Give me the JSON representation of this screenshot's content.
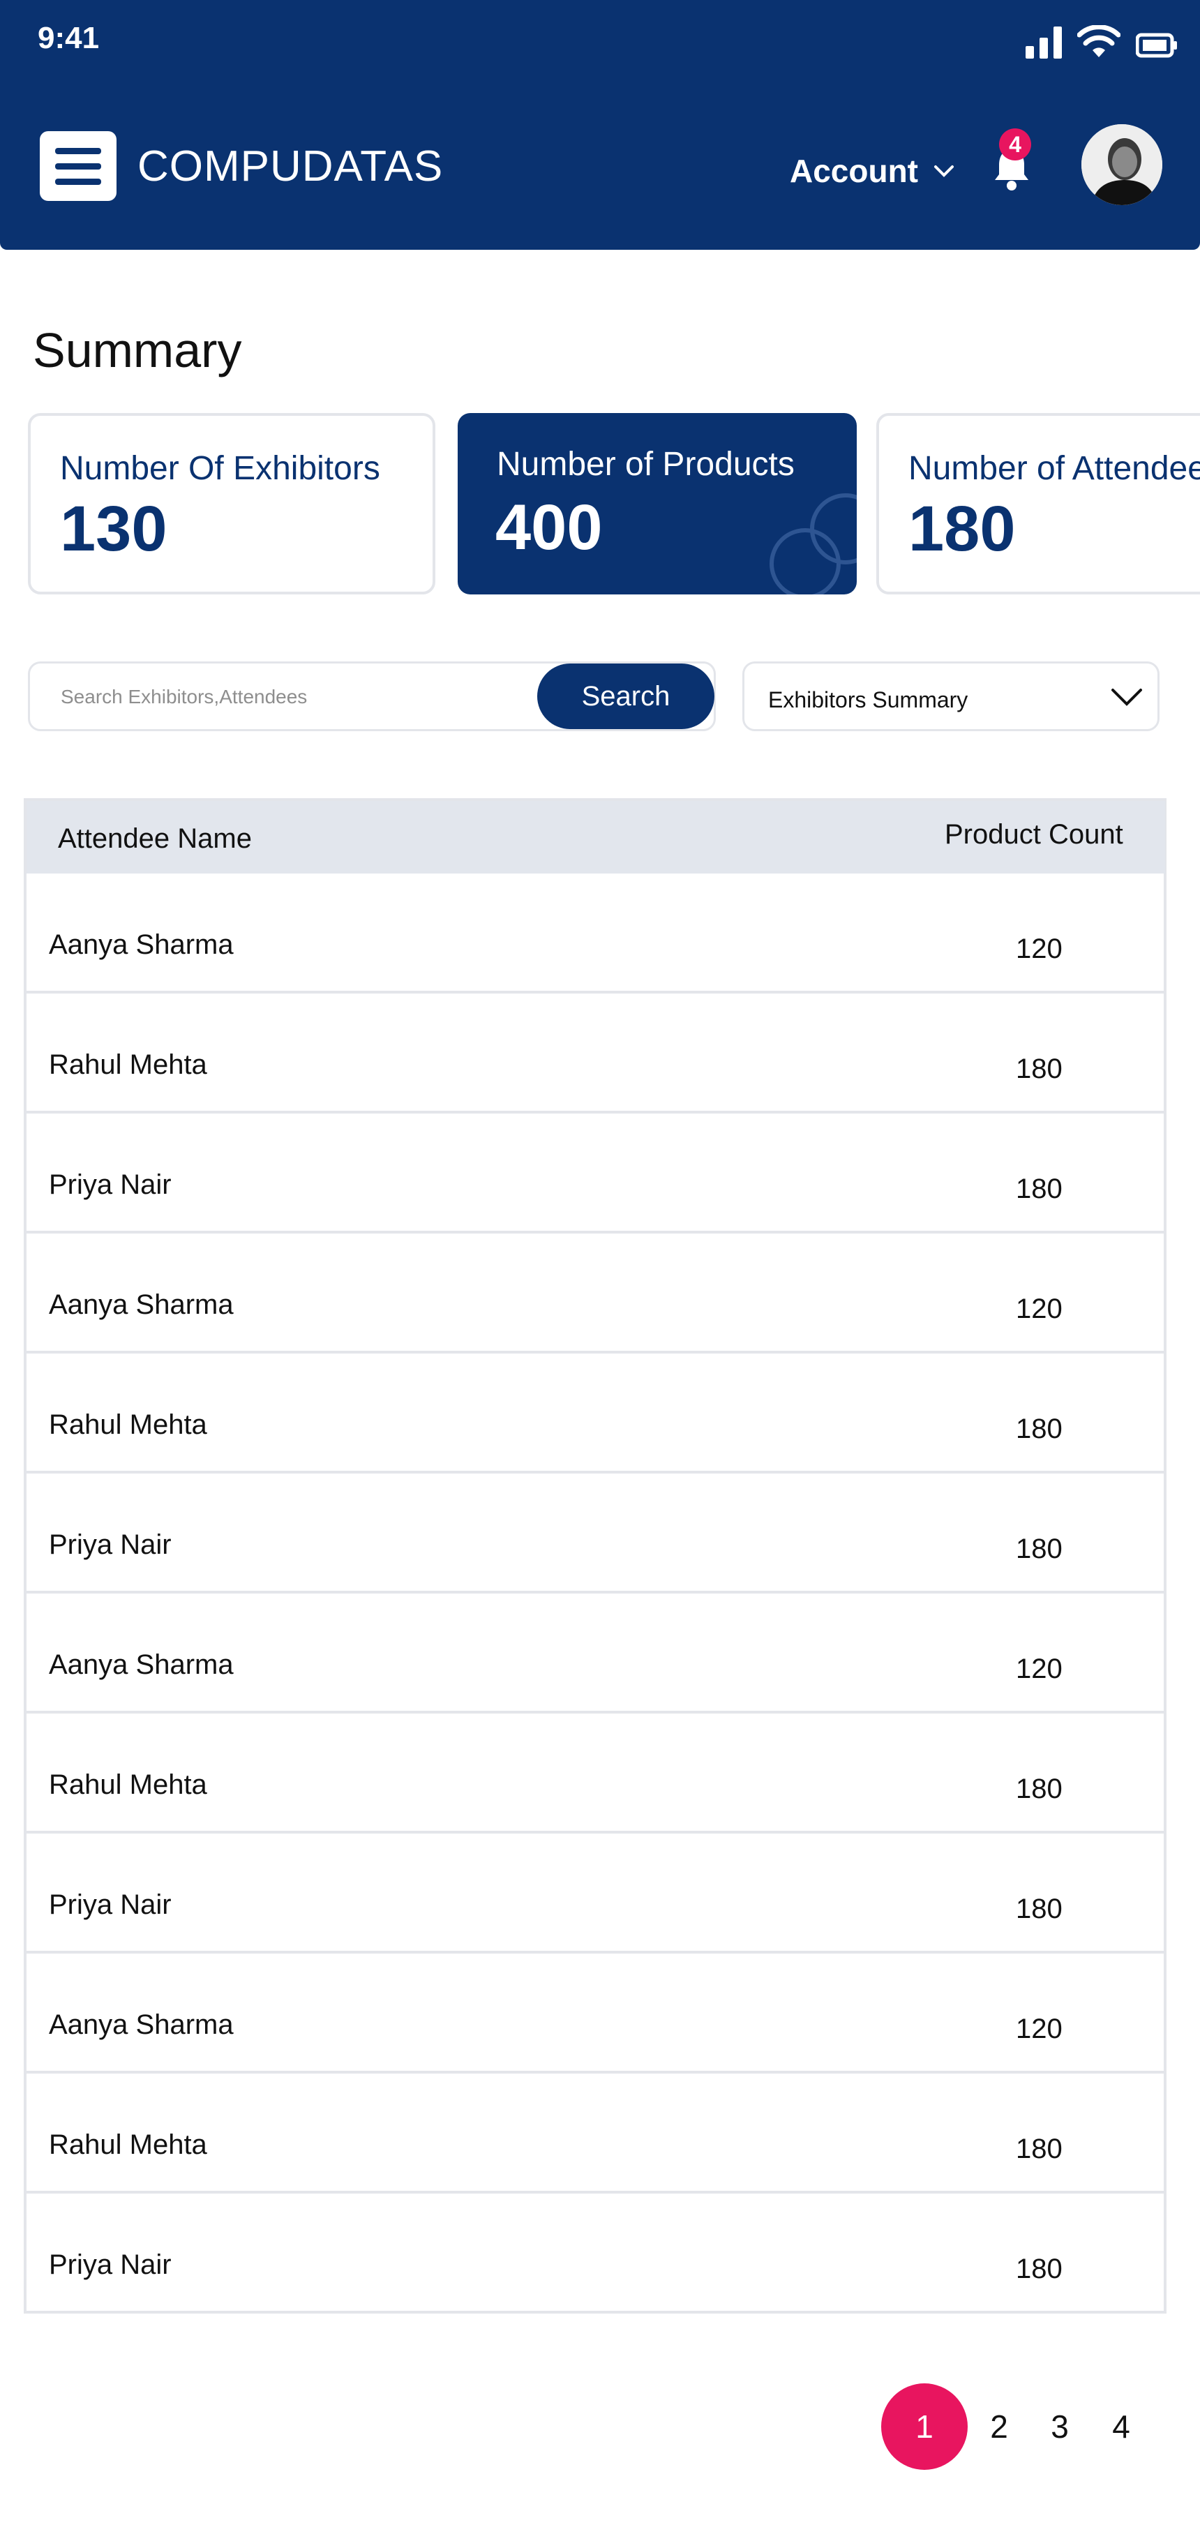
{
  "status_bar": {
    "time": "9:41"
  },
  "header": {
    "brand": "COMPUDATAS",
    "account_label": "Account",
    "notification_count": "4"
  },
  "summary": {
    "title": "Summary",
    "cards": [
      {
        "label": "Number Of Exhibitors",
        "value": "130"
      },
      {
        "label": "Number of Products",
        "value": "400"
      },
      {
        "label": "Number of Attendee",
        "value": "180"
      }
    ]
  },
  "search": {
    "placeholder": "Search Exhibitors,Attendees",
    "button_label": "Search"
  },
  "filter": {
    "selected": "Exhibitors Summary"
  },
  "table": {
    "headers": {
      "name": "Attendee Name",
      "count": "Product Count"
    },
    "rows": [
      {
        "name": "Aanya Sharma",
        "count": "120"
      },
      {
        "name": "Rahul Mehta",
        "count": "180"
      },
      {
        "name": "Priya Nair",
        "count": "180"
      },
      {
        "name": "Aanya Sharma",
        "count": "120"
      },
      {
        "name": "Rahul Mehta",
        "count": "180"
      },
      {
        "name": "Priya Nair",
        "count": "180"
      },
      {
        "name": "Aanya Sharma",
        "count": "120"
      },
      {
        "name": "Rahul Mehta",
        "count": "180"
      },
      {
        "name": "Priya Nair",
        "count": "180"
      },
      {
        "name": "Aanya Sharma",
        "count": "120"
      },
      {
        "name": "Rahul Mehta",
        "count": "180"
      },
      {
        "name": "Priya Nair",
        "count": "180"
      }
    ]
  },
  "pagination": {
    "pages": [
      "1",
      "2",
      "3",
      "4"
    ],
    "current": "1"
  },
  "colors": {
    "primary": "#0a3270",
    "accent": "#e8155f",
    "table_header": "#e2e6ed",
    "border": "#e3e5ea"
  }
}
